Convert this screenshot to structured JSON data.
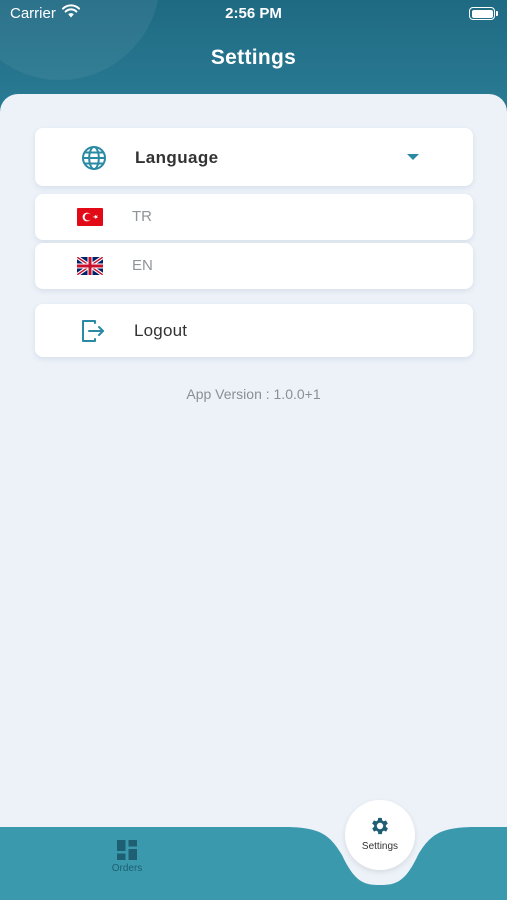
{
  "status_bar": {
    "carrier": "Carrier",
    "time": "2:56 PM",
    "wifi_icon": "wifi-icon",
    "battery_icon": "battery-icon"
  },
  "header": {
    "title": "Settings"
  },
  "language_card": {
    "label": "Language",
    "icon": "globe-icon",
    "expand_icon": "caret-down-icon"
  },
  "languages": [
    {
      "code": "TR",
      "flag": "turkey-flag-icon"
    },
    {
      "code": "EN",
      "flag": "uk-flag-icon"
    }
  ],
  "logout": {
    "label": "Logout",
    "icon": "logout-icon"
  },
  "app_version": "App Version : 1.0.0+1",
  "bottom_nav": {
    "items": [
      {
        "label": "Orders",
        "icon": "dashboard-icon",
        "active": false
      },
      {
        "label": "Settings",
        "icon": "gear-icon",
        "active": true
      }
    ]
  },
  "colors": {
    "accent": "#2a8aa3",
    "header": "#27768f",
    "nav_bar": "#3a99ad",
    "background": "#edf2f9"
  }
}
